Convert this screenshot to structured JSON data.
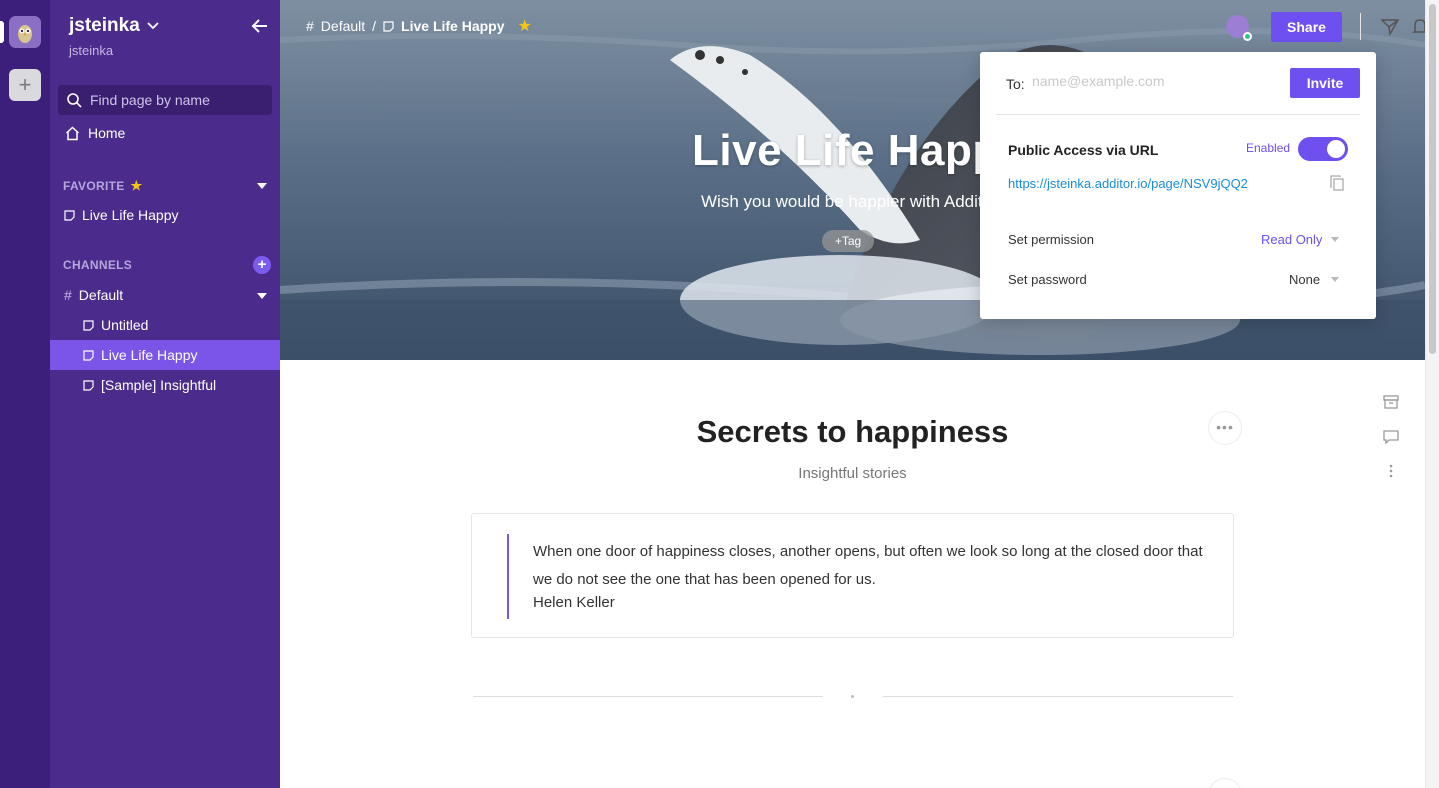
{
  "workspace": {
    "name": "jsteinka",
    "user": "jsteinka"
  },
  "sidebar": {
    "search_placeholder": "Find page by name",
    "home_label": "Home",
    "favorite_header": "FAVORITE",
    "favorites": [
      {
        "label": "Live Life Happy"
      }
    ],
    "channels_header": "CHANNELS",
    "channel": {
      "label": "Default"
    },
    "pages": [
      {
        "label": "Untitled"
      },
      {
        "label": "Live Life Happy",
        "selected": true
      },
      {
        "label": "[Sample] Insightful"
      }
    ]
  },
  "breadcrumb": {
    "channel": "Default",
    "separator": "/",
    "page": "Live Life Happy"
  },
  "topbar": {
    "share_label": "Share"
  },
  "hero": {
    "title": "Live Life Happy",
    "subtitle": "Wish you would be happier with Additor",
    "tag_label": "+Tag"
  },
  "share_popup": {
    "to_label": "To:",
    "to_placeholder": "name@example.com",
    "invite_label": "Invite",
    "public_access_label": "Public Access via URL",
    "public_access_status": "Enabled",
    "public_access_on": true,
    "url": "https://jsteinka.additor.io/page/NSV9jQQ2",
    "permission_label": "Set permission",
    "permission_value": "Read Only",
    "password_label": "Set password",
    "password_value": "None"
  },
  "content": {
    "title": "Secrets to happiness",
    "subtitle": "Insightful stories",
    "quote": "When one door of happiness closes, another opens, but often we look so long at the closed door that we do not see the one that has been opened for us.",
    "quote_author": "Helen Keller"
  },
  "colors": {
    "accent": "#6e4ff0",
    "sidebar_bg": "#4b2c8c",
    "rail_bg": "#3b1f7a",
    "selected_item": "#7a55e8",
    "link": "#1a8cd8"
  }
}
